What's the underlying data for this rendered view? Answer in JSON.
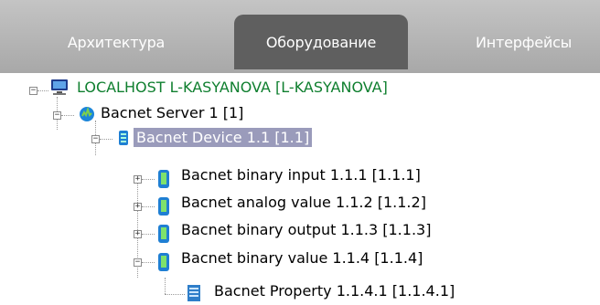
{
  "tabs": [
    {
      "label": "Архитектура",
      "active": false
    },
    {
      "label": "Оборудование",
      "active": true
    },
    {
      "label": "Интерфейсы",
      "active": false
    }
  ],
  "tree": {
    "root": "LOCALHOST L-KASYANOVA [L-KASYANOVA]",
    "server": "Bacnet Server 1 [1]",
    "device": "Bacnet Device 1.1 [1.1]",
    "items": [
      "Bacnet binary input 1.1.1 [1.1.1]",
      "Bacnet analog value 1.1.2 [1.1.2]",
      "Bacnet binary output 1.1.3 [1.1.3]",
      "Bacnet binary value 1.1.4 [1.1.4]"
    ],
    "property": "Bacnet Property 1.1.4.1 [1.1.4.1]"
  },
  "colors": {
    "tab_active_bg": "#5f5f5f",
    "tabbar_bg": "#b4b4b4",
    "selected_bg": "#9a9bbb",
    "root_text": "#0f7f2f"
  }
}
